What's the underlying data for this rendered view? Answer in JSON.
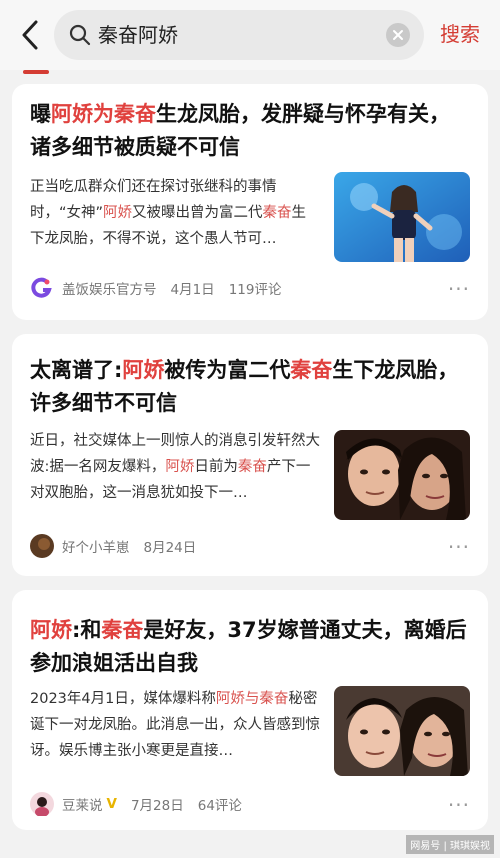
{
  "search": {
    "query": "秦奋阿娇",
    "button_label": "搜索"
  },
  "articles": [
    {
      "title_parts": [
        "曝",
        "阿娇为秦奋",
        "生龙凤胎，发胖疑与怀孕有关，诸多细节被质疑不可信"
      ],
      "snippet_parts": [
        "正当吃瓜群众们还在探讨张继科的事情时，“女神”",
        "阿娇",
        "又被曝出曾为富二代",
        "秦奋",
        "生下龙凤胎，不得不说，这个愚人节可…"
      ],
      "source": "盖饭娱乐官方号",
      "date": "4月1日",
      "comments": "119评论",
      "more": "···"
    },
    {
      "title_parts": [
        "太离谱了:",
        "阿娇",
        "被传为富二代",
        "秦奋",
        "生下龙凤胎，许多细节不可信"
      ],
      "snippet_parts": [
        "近日，社交媒体上一则惊人的消息引发轩然大波:据一名网友爆料，",
        "阿娇",
        "日前为",
        "秦奋",
        "产下一对双胞胎，这一消息犹如投下一…"
      ],
      "source": "好个小羊崽",
      "date": "8月24日",
      "more": "···"
    },
    {
      "title_parts": [
        "阿娇",
        ":和",
        "秦奋",
        "是好友，37岁嫁普通丈夫，离婚后参加浪姐活出自我"
      ],
      "snippet_parts": [
        "2023年4月1日，媒体爆料称",
        "阿娇与秦奋",
        "秘密诞下一对龙凤胎。此消息一出，众人皆感到惊讶。娱乐博主张小寒更是直接…"
      ],
      "source": "豆莱说",
      "verified": "V",
      "date": "7月28日",
      "comments": "64评论",
      "more": "···"
    }
  ],
  "watermark": "网易号 | 琪琪娱视",
  "colors": {
    "accent": "#d43c33",
    "highlight": "#e0413e"
  },
  "icons": [
    "back-arrow-icon",
    "search-icon",
    "clear-icon",
    "more-icon"
  ]
}
